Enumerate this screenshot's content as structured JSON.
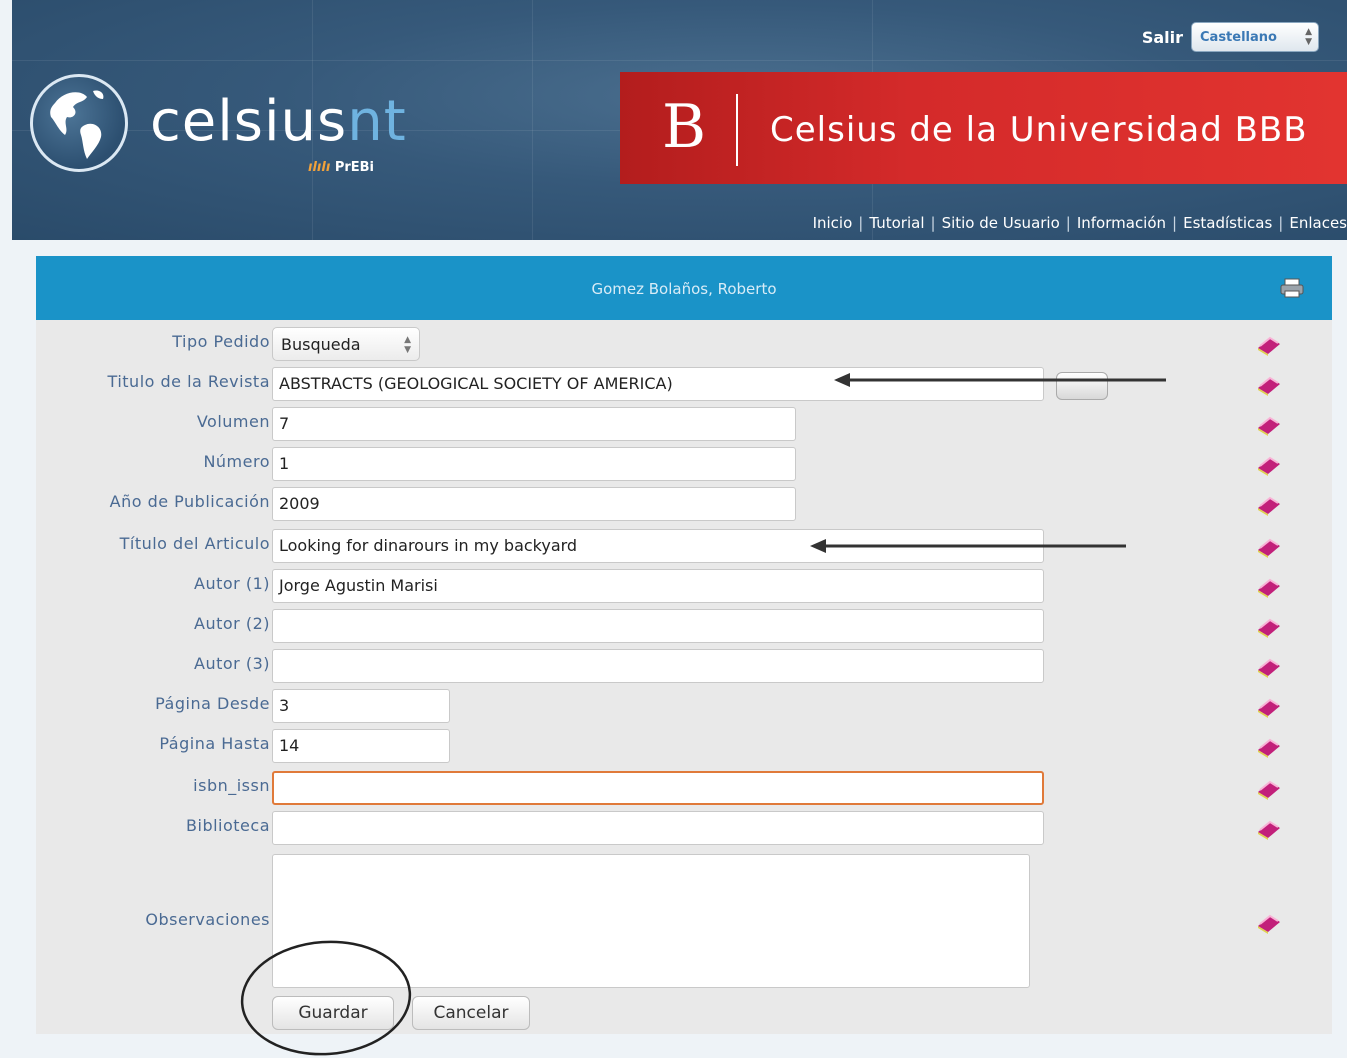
{
  "header": {
    "brand_main": "celsius",
    "brand_accent": "nt",
    "brand_sub_mark": "ılılı",
    "brand_sub": "PrEBi",
    "salir": "Salir",
    "language": "Castellano",
    "banner_letter": "B",
    "banner_title": "Celsius de la Universidad BBB",
    "nav": [
      "Inicio",
      "Tutorial",
      "Sitio de Usuario",
      "Información",
      "Estadísticas",
      "Enlaces"
    ],
    "nav_separator": "|"
  },
  "panel": {
    "user_name": "Gomez Bolaños, Roberto",
    "fields": {
      "tipo_pedido": {
        "label": "Tipo Pedido",
        "value": "Busqueda"
      },
      "titulo_revista": {
        "label": "Titulo de la Revista",
        "value": "ABSTRACTS (GEOLOGICAL SOCIETY OF AMERICA)"
      },
      "volumen": {
        "label": "Volumen",
        "value": "7"
      },
      "numero": {
        "label": "Número",
        "value": "1"
      },
      "anio": {
        "label": "Año de Publicación",
        "value": "2009"
      },
      "titulo_articulo": {
        "label": "Título del Articulo",
        "value": "Looking for dinarours in my backyard"
      },
      "autor1": {
        "label": "Autor (1)",
        "value": "Jorge Agustin Marisi"
      },
      "autor2": {
        "label": "Autor (2)",
        "value": ""
      },
      "autor3": {
        "label": "Autor (3)",
        "value": ""
      },
      "pagina_desde": {
        "label": "Página Desde",
        "value": "3"
      },
      "pagina_hasta": {
        "label": "Página Hasta",
        "value": "14"
      },
      "isbn_issn": {
        "label": "isbn_issn",
        "value": ""
      },
      "biblioteca": {
        "label": "Biblioteca",
        "value": ""
      },
      "observaciones": {
        "label": "Observaciones",
        "value": ""
      }
    },
    "save_label": "Guardar",
    "cancel_label": "Cancelar"
  },
  "colors": {
    "header_bg": "#36597a",
    "banner_red": "#d42a2a",
    "panel_head": "#1a93c8",
    "label_text": "#4a6a93",
    "focus_border": "#e07a3a",
    "help_icon": "#c2207a"
  },
  "icons": [
    "globe-logo-icon",
    "print-icon",
    "help-book-icon",
    "spinner-arrows-icon"
  ]
}
